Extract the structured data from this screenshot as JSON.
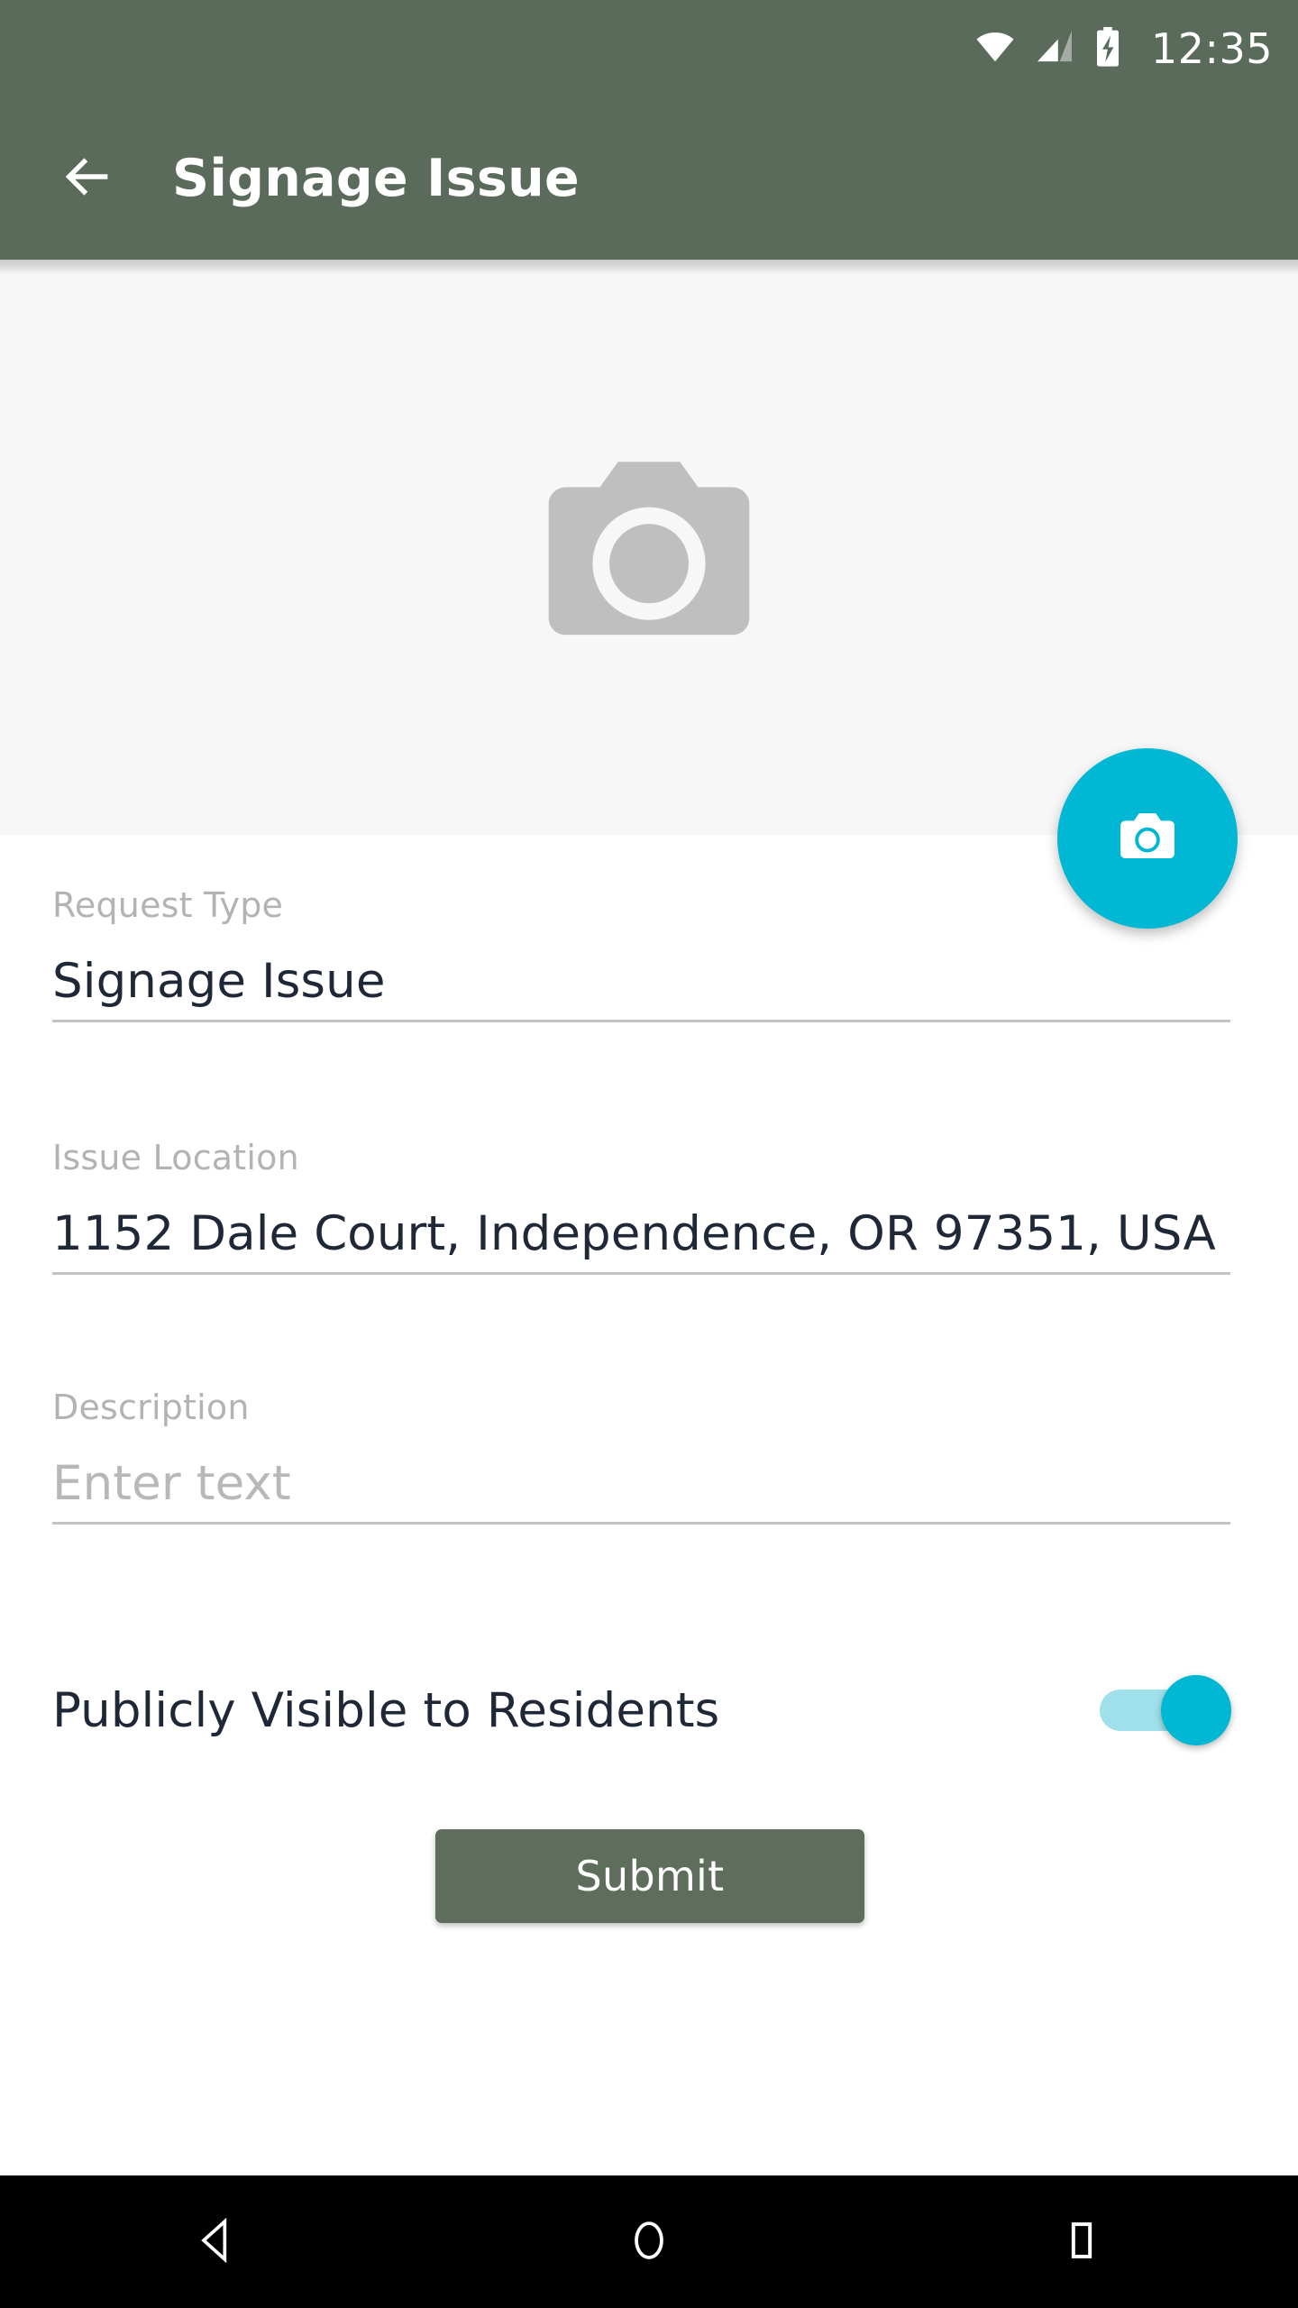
{
  "status_bar": {
    "time": "12:35",
    "icons": [
      "wifi-icon",
      "cellular-signal-icon",
      "battery-charging-icon"
    ]
  },
  "app_bar": {
    "back_icon": "arrow-left-icon",
    "title": "Signage Issue",
    "background_color": "#5a6b5c",
    "text_color": "#ffffff"
  },
  "photo_area": {
    "placeholder_icon": "camera-placeholder-icon",
    "background_color": "#f7f7f7",
    "icon_color": "#bfbfbf"
  },
  "fab": {
    "icon": "camera-icon",
    "color": "#00b7d4",
    "icon_color": "#ffffff"
  },
  "form": {
    "fields": [
      {
        "label": "Request Type",
        "value": "Signage Issue",
        "is_placeholder": false
      },
      {
        "label": "Issue Location",
        "value": "1152 Dale Court, Independence, OR 97351, USA",
        "is_placeholder": false
      },
      {
        "label": "Description",
        "value": "Enter text",
        "placeholder": "Enter text",
        "is_placeholder": true
      }
    ],
    "toggle": {
      "label": "Publicly Visible to Residents",
      "state": "on",
      "track_color": "#9fe0ea",
      "thumb_color": "#00b7d4"
    },
    "submit": {
      "label": "Submit",
      "color": "#5e6d5c",
      "text_color": "#ffffff"
    }
  },
  "nav_bar": {
    "background_color": "#000000",
    "buttons": [
      {
        "name": "back-nav-icon"
      },
      {
        "name": "home-nav-icon"
      },
      {
        "name": "recents-nav-icon"
      }
    ]
  }
}
